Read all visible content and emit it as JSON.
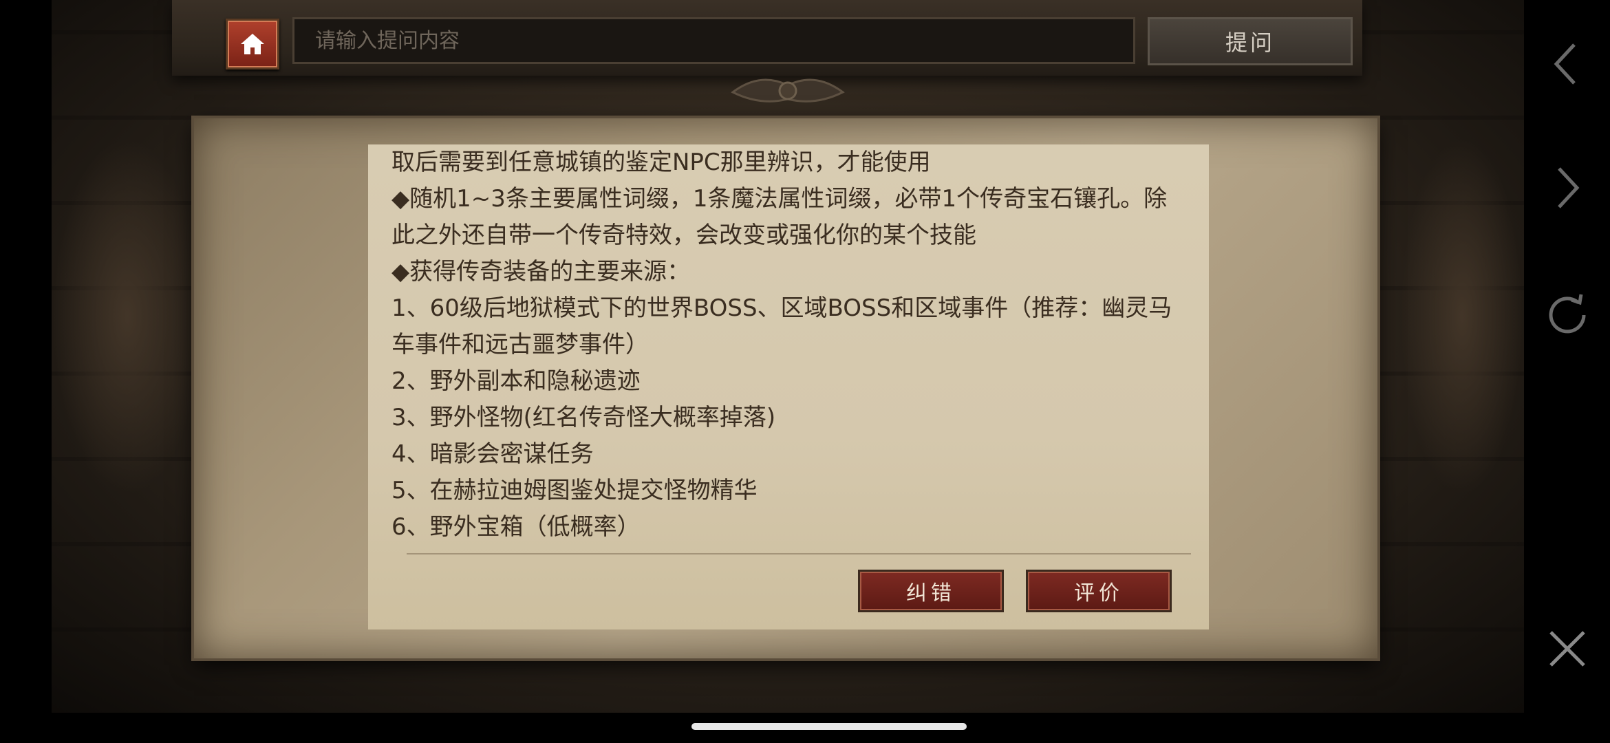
{
  "toolbar": {
    "home_icon": "home-icon",
    "search_placeholder": "请输入提问内容",
    "ask_label": "提问"
  },
  "article": {
    "lines": [
      "取后需要到任意城镇的鉴定NPC那里辨识，才能使用",
      "◆随机1~3条主要属性词缀，1条魔法属性词缀，必带1个传奇宝石镶孔。除此之外还自带一个传奇特效，会改变或强化你的某个技能",
      "◆获得传奇装备的主要来源：",
      "1、60级后地狱模式下的世界BOSS、区域BOSS和区域事件（推荐：幽灵马车事件和远古噩梦事件）",
      "2、野外副本和隐秘遗迹",
      "3、野外怪物(红名传奇怪大概率掉落)",
      "4、暗影会密谋任务",
      "5、在赫拉迪姆图鉴处提交怪物精华",
      "6、野外宝箱（低概率）"
    ]
  },
  "actions": {
    "correct_label": "纠错",
    "rate_label": "评价"
  },
  "navigation": {
    "back_icon": "chevron-left-icon",
    "forward_icon": "chevron-right-icon",
    "refresh_icon": "refresh-icon",
    "close_icon": "close-icon"
  },
  "colors": {
    "accent_red": "#7e2a22",
    "parchment": "#d8ccb2",
    "text_brown": "#3a2d20"
  }
}
